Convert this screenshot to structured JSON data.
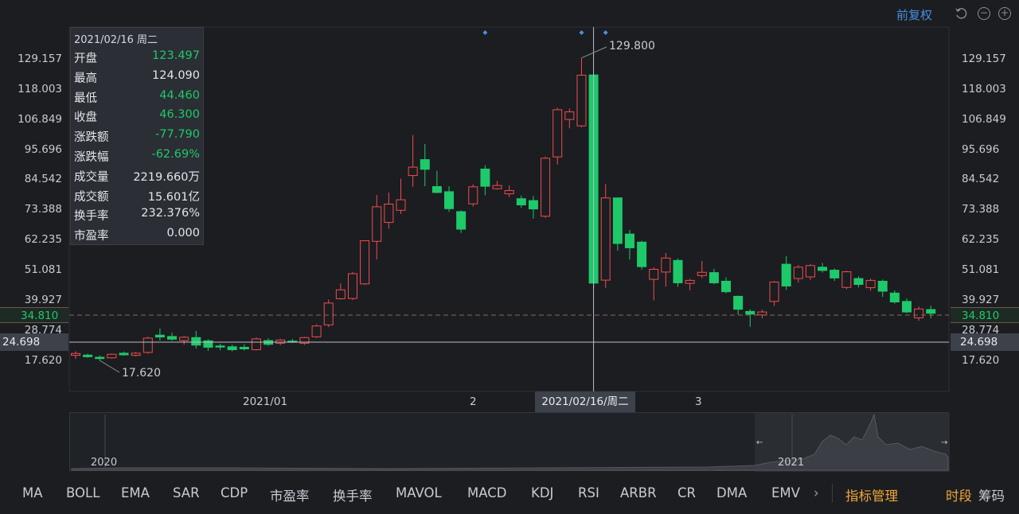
{
  "toolbar": {
    "adjust_label": "前复权",
    "undo_icon": "undo-icon",
    "zoom_out_icon": "zoom-out-icon",
    "zoom_in_icon": "zoom-in-icon"
  },
  "colors": {
    "up": "#f24c4c",
    "down": "#1ec96a",
    "background": "#1b1d21",
    "accent": "#4a8de0",
    "orange": "#f0a636"
  },
  "tooltip": {
    "date": "2021/02/16 周二",
    "rows": [
      {
        "label": "开盘",
        "value": "123.497",
        "color": "#1ec96a"
      },
      {
        "label": "最高",
        "value": "124.090",
        "color": "#e3e6ea"
      },
      {
        "label": "最低",
        "value": "44.460",
        "color": "#1ec96a"
      },
      {
        "label": "收盘",
        "value": "46.300",
        "color": "#1ec96a"
      },
      {
        "label": "涨跌额",
        "value": "-77.790",
        "color": "#1ec96a"
      },
      {
        "label": "涨跌幅",
        "value": "-62.69%",
        "color": "#1ec96a"
      },
      {
        "label": "成交量",
        "value": "2219.660万",
        "color": "#e3e6ea"
      },
      {
        "label": "成交额",
        "value": "15.601亿",
        "color": "#e3e6ea"
      },
      {
        "label": "换手率",
        "value": "232.376%",
        "color": "#e3e6ea"
      },
      {
        "label": "市盈率",
        "value": "0.000",
        "color": "#e3e6ea"
      }
    ]
  },
  "y_axis_ticks": [
    "129.157",
    "118.003",
    "106.849",
    "95.696",
    "84.542",
    "73.388",
    "62.235",
    "51.081",
    "39.927",
    "28.774",
    "17.620"
  ],
  "current_price": "34.810",
  "crosshair_price": "24.698",
  "max_marker": "129.800",
  "min_marker": "17.620",
  "x_axis": {
    "labels": [
      "2021/01",
      "2",
      "3"
    ],
    "selected": "2021/02/16/周二"
  },
  "overview": {
    "labels": [
      "2020",
      "2021"
    ]
  },
  "indicators": [
    "MA",
    "BOLL",
    "EMA",
    "SAR",
    "CDP",
    "市盈率",
    "换手率",
    "MAVOL",
    "MACD",
    "KDJ",
    "RSI",
    "ARBR",
    "CR",
    "DMA",
    "EMV"
  ],
  "indicator_more_icon": "chevron-right-icon",
  "indicator_manage": "指标管理",
  "tabs": [
    "时段",
    "筹码"
  ],
  "chart_data": {
    "type": "candlestick",
    "ylim": [
      17.62,
      129.157
    ],
    "candles": [
      {
        "o": 19.5,
        "h": 21.0,
        "l": 18.2,
        "c": 20.2
      },
      {
        "o": 19.6,
        "h": 20.1,
        "l": 18.6,
        "c": 19.0
      },
      {
        "o": 18.8,
        "h": 19.5,
        "l": 17.62,
        "c": 18.3
      },
      {
        "o": 18.6,
        "h": 20.2,
        "l": 18.3,
        "c": 19.9
      },
      {
        "o": 20.3,
        "h": 20.9,
        "l": 19.4,
        "c": 19.7
      },
      {
        "o": 19.5,
        "h": 20.8,
        "l": 19.1,
        "c": 20.3
      },
      {
        "o": 20.6,
        "h": 26.4,
        "l": 20.1,
        "c": 25.9
      },
      {
        "o": 27.0,
        "h": 29.5,
        "l": 25.0,
        "c": 26.3
      },
      {
        "o": 26.5,
        "h": 28.0,
        "l": 24.9,
        "c": 25.5
      },
      {
        "o": 25.0,
        "h": 26.7,
        "l": 23.5,
        "c": 26.2
      },
      {
        "o": 26.1,
        "h": 28.6,
        "l": 22.0,
        "c": 23.3
      },
      {
        "o": 24.9,
        "h": 25.5,
        "l": 21.2,
        "c": 22.5
      },
      {
        "o": 23.0,
        "h": 23.8,
        "l": 21.4,
        "c": 22.6
      },
      {
        "o": 22.7,
        "h": 23.4,
        "l": 21.0,
        "c": 21.6
      },
      {
        "o": 22.5,
        "h": 23.6,
        "l": 21.3,
        "c": 21.9
      },
      {
        "o": 21.6,
        "h": 26.2,
        "l": 21.3,
        "c": 25.6
      },
      {
        "o": 25.0,
        "h": 25.8,
        "l": 23.0,
        "c": 23.6
      },
      {
        "o": 24.0,
        "h": 25.6,
        "l": 23.3,
        "c": 25.2
      },
      {
        "o": 24.8,
        "h": 25.6,
        "l": 24.1,
        "c": 24.5
      },
      {
        "o": 24.0,
        "h": 26.4,
        "l": 23.4,
        "c": 26.1
      },
      {
        "o": 26.4,
        "h": 31.0,
        "l": 26.0,
        "c": 30.4
      },
      {
        "o": 30.8,
        "h": 40.2,
        "l": 30.0,
        "c": 38.9
      },
      {
        "o": 40.5,
        "h": 46.2,
        "l": 40.2,
        "c": 43.8
      },
      {
        "o": 40.6,
        "h": 50.4,
        "l": 40.0,
        "c": 49.8
      },
      {
        "o": 46.0,
        "h": 62.2,
        "l": 45.6,
        "c": 62.0
      },
      {
        "o": 61.8,
        "h": 79.0,
        "l": 55.0,
        "c": 74.6
      },
      {
        "o": 68.8,
        "h": 79.9,
        "l": 66.5,
        "c": 75.6
      },
      {
        "o": 73.3,
        "h": 85.0,
        "l": 72.0,
        "c": 77.2
      },
      {
        "o": 86.2,
        "h": 101.2,
        "l": 82.0,
        "c": 89.3
      },
      {
        "o": 92.1,
        "h": 97.9,
        "l": 82.2,
        "c": 88.5
      },
      {
        "o": 82.1,
        "h": 88.0,
        "l": 79.6,
        "c": 79.9
      },
      {
        "o": 80.2,
        "h": 82.2,
        "l": 72.7,
        "c": 73.9
      },
      {
        "o": 72.8,
        "h": 73.3,
        "l": 64.9,
        "c": 66.3
      },
      {
        "o": 75.7,
        "h": 82.9,
        "l": 74.7,
        "c": 82.0
      },
      {
        "o": 88.6,
        "h": 90.0,
        "l": 78.9,
        "c": 82.2
      },
      {
        "o": 81.3,
        "h": 84.2,
        "l": 81.0,
        "c": 82.5
      },
      {
        "o": 79.4,
        "h": 82.6,
        "l": 78.2,
        "c": 80.6
      },
      {
        "o": 77.6,
        "h": 78.8,
        "l": 74.2,
        "c": 75.3
      },
      {
        "o": 76.9,
        "h": 78.6,
        "l": 70.2,
        "c": 73.8
      },
      {
        "o": 71.1,
        "h": 93.2,
        "l": 70.5,
        "c": 92.6
      },
      {
        "o": 93.1,
        "h": 111.3,
        "l": 90.3,
        "c": 110.6
      },
      {
        "o": 107.0,
        "h": 111.0,
        "l": 103.7,
        "c": 109.8
      },
      {
        "o": 104.6,
        "h": 129.8,
        "l": 104.1,
        "c": 123.4
      },
      {
        "o": 123.497,
        "h": 124.09,
        "l": 44.46,
        "c": 46.3
      },
      {
        "o": 47.4,
        "h": 83.0,
        "l": 44.5,
        "c": 77.9
      },
      {
        "o": 77.9,
        "h": 77.9,
        "l": 58.3,
        "c": 61.0
      },
      {
        "o": 64.5,
        "h": 66.0,
        "l": 55.0,
        "c": 59.4
      },
      {
        "o": 61.5,
        "h": 62.0,
        "l": 51.3,
        "c": 52.4
      },
      {
        "o": 47.7,
        "h": 52.1,
        "l": 39.9,
        "c": 51.4
      },
      {
        "o": 50.4,
        "h": 57.5,
        "l": 45.0,
        "c": 55.6
      },
      {
        "o": 54.7,
        "h": 55.5,
        "l": 44.9,
        "c": 46.4
      },
      {
        "o": 46.2,
        "h": 47.9,
        "l": 43.6,
        "c": 47.3
      },
      {
        "o": 49.1,
        "h": 54.5,
        "l": 48.1,
        "c": 50.3
      },
      {
        "o": 50.2,
        "h": 51.6,
        "l": 45.9,
        "c": 46.4
      },
      {
        "o": 47.0,
        "h": 48.4,
        "l": 42.5,
        "c": 43.1
      },
      {
        "o": 41.4,
        "h": 41.7,
        "l": 34.6,
        "c": 36.6
      },
      {
        "o": 35.8,
        "h": 36.6,
        "l": 30.1,
        "c": 34.8
      },
      {
        "o": 34.5,
        "h": 36.4,
        "l": 33.2,
        "c": 35.6
      },
      {
        "o": 39.5,
        "h": 47.1,
        "l": 37.8,
        "c": 46.7
      },
      {
        "o": 53.3,
        "h": 56.3,
        "l": 43.8,
        "c": 45.2
      },
      {
        "o": 48.0,
        "h": 53.0,
        "l": 46.5,
        "c": 52.2
      },
      {
        "o": 48.6,
        "h": 53.3,
        "l": 47.5,
        "c": 52.8
      },
      {
        "o": 52.2,
        "h": 53.8,
        "l": 50.2,
        "c": 51.0
      },
      {
        "o": 51.1,
        "h": 51.7,
        "l": 47.1,
        "c": 48.2
      },
      {
        "o": 44.7,
        "h": 50.9,
        "l": 44.0,
        "c": 50.5
      },
      {
        "o": 48.0,
        "h": 48.8,
        "l": 44.7,
        "c": 45.8
      },
      {
        "o": 44.6,
        "h": 48.0,
        "l": 43.5,
        "c": 47.3
      },
      {
        "o": 47.0,
        "h": 47.6,
        "l": 41.2,
        "c": 43.3
      },
      {
        "o": 42.6,
        "h": 43.6,
        "l": 38.7,
        "c": 39.3
      },
      {
        "o": 39.5,
        "h": 40.6,
        "l": 35.2,
        "c": 35.6
      },
      {
        "o": 33.4,
        "h": 37.6,
        "l": 32.3,
        "c": 36.7
      },
      {
        "o": 36.5,
        "h": 37.9,
        "l": 33.2,
        "c": 35.1
      }
    ]
  }
}
